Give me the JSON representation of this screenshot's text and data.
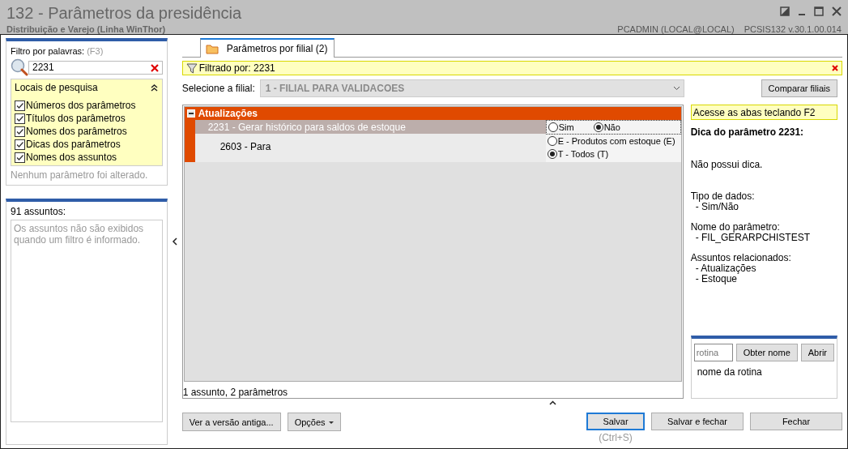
{
  "window": {
    "title": "132 - Parâmetros da presidência",
    "subtitle": "Distribuição e Varejo (Linha WinThor)",
    "user": "PCADMIN (LOCAL@LOCAL)",
    "version": "PCSIS132  v.30.1.00.014"
  },
  "filter": {
    "label": "Filtro por palavras:",
    "hint": "(F3)",
    "value": "2231"
  },
  "search_locations": {
    "title": "Locais de pesquisa",
    "expanded": true,
    "options": [
      {
        "label": "Números dos parâmetros",
        "checked": true
      },
      {
        "label": "Títulos dos parâmetros",
        "checked": true
      },
      {
        "label": "Nomes dos parâmetros",
        "checked": true
      },
      {
        "label": "Dicas dos parâmetros",
        "checked": true
      },
      {
        "label": "Nomes dos assuntos",
        "checked": true
      }
    ]
  },
  "status_note": "Nenhum parâmetro foi alterado.",
  "subjects": {
    "count_label": "91 assuntos:",
    "note": "Os assuntos não são exibidos quando um filtro é informado."
  },
  "tabs": [
    {
      "label": "Parâmetros por filial  (2)",
      "selected": true
    }
  ],
  "filter_banner": "Filtrado por: 2231",
  "branch_select": {
    "label": "Selecione a filial:",
    "value": "1 - FILIAL PARA VALIDACOES",
    "disabled": true
  },
  "compare_button": "Comparar filiais",
  "group": {
    "title": "Atualizações",
    "expanded": true,
    "parameters": [
      {
        "label": "2231 - Gerar histórico para saldos de estoque",
        "selected": true,
        "kind": "inline",
        "options": [
          {
            "label": "Sim",
            "selected": false
          },
          {
            "label": "Não",
            "selected": true
          }
        ]
      },
      {
        "label": "2603 - Para",
        "selected": false,
        "kind": "stacked",
        "options": [
          {
            "label": "E - Produtos com estoque (E)",
            "selected": false
          },
          {
            "label": "T - Todos (T)",
            "selected": true
          }
        ]
      }
    ]
  },
  "grid_footer": "1 assunto, 2 parâmetros",
  "tip": {
    "hint": "Acesse as abas teclando F2",
    "title": "Dica do parâmetro 2231:",
    "body": "Não possui dica.",
    "sections": [
      {
        "heading": "Tipo de dados:",
        "items": [
          "- Sim/Não"
        ]
      },
      {
        "heading": "Nome do parâmetro:",
        "items": [
          "- FIL_GERARPCHISTEST"
        ]
      },
      {
        "heading": "Assuntos relacionados:",
        "items": [
          "- Atualizações",
          "- Estoque"
        ]
      }
    ]
  },
  "routine": {
    "placeholder": "rotina",
    "buttons": [
      "Obter nome",
      "Abrir"
    ],
    "caption": "nome da rotina"
  },
  "footer_buttons": {
    "left": [
      {
        "label": "Ver a versão antiga...",
        "kind": "plain"
      },
      {
        "label": "Opções",
        "kind": "dropdown"
      }
    ],
    "right": [
      {
        "label": "Salvar",
        "kind": "default",
        "hint": "(Ctrl+S)"
      },
      {
        "label": "Salvar e fechar",
        "kind": "plain"
      },
      {
        "label": "Fechar",
        "kind": "plain"
      }
    ]
  }
}
